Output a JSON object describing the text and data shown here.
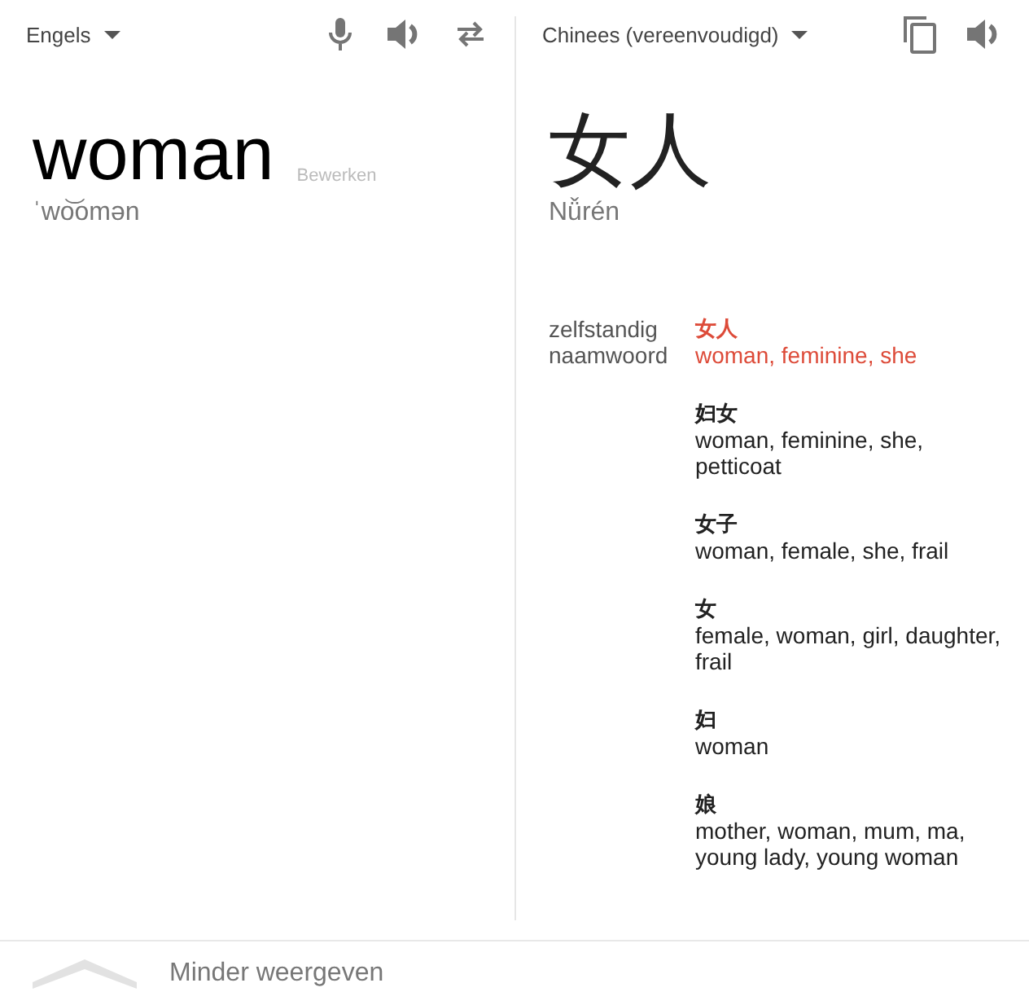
{
  "source": {
    "language": "Engels",
    "text": "woman",
    "edit_label": "Bewerken",
    "phonetic": "ˈwo͝omən"
  },
  "target": {
    "language": "Chinees (vereenvoudigd)",
    "text": "女人",
    "romanization": "Nǚrén"
  },
  "dictionary": {
    "part_of_speech": "zelfstandig naamwoord",
    "entries": [
      {
        "word": "女人",
        "meanings": "woman, feminine, she",
        "highlighted": true
      },
      {
        "word": "妇女",
        "meanings": "woman, feminine, she, petticoat",
        "highlighted": false
      },
      {
        "word": "女子",
        "meanings": "woman, female, she, frail",
        "highlighted": false
      },
      {
        "word": "女",
        "meanings": "female, woman, girl, daughter, frail",
        "highlighted": false
      },
      {
        "word": "妇",
        "meanings": "woman",
        "highlighted": false
      },
      {
        "word": "娘",
        "meanings": "mother, woman, mum, ma, young lady, young woman",
        "highlighted": false
      }
    ]
  },
  "footer": {
    "label": "Minder weergeven"
  }
}
